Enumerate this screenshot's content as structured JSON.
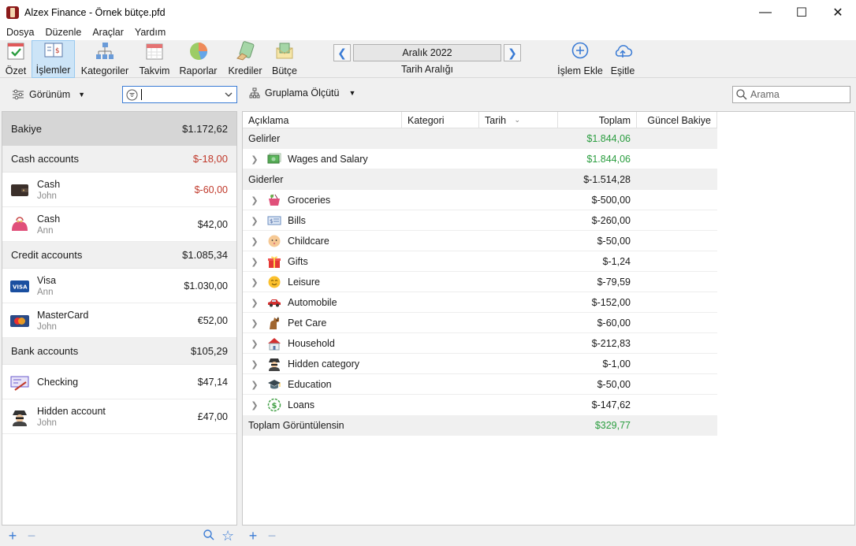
{
  "window": {
    "title": "Alzex Finance - Örnek bütçe.pfd"
  },
  "menu": [
    "Dosya",
    "Düzenle",
    "Araçlar",
    "Yardım"
  ],
  "toolbar": {
    "tools": [
      {
        "label": "Özet",
        "icon": "summary-icon"
      },
      {
        "label": "İşlemler",
        "icon": "transactions-icon",
        "active": true
      },
      {
        "label": "Kategoriler",
        "icon": "categories-icon"
      },
      {
        "label": "Takvim",
        "icon": "calendar-icon"
      },
      {
        "label": "Raporlar",
        "icon": "reports-icon"
      },
      {
        "label": "Krediler",
        "icon": "loans-icon"
      },
      {
        "label": "Bütçe",
        "icon": "budget-icon"
      }
    ],
    "date_range": {
      "value": "Aralık 2022",
      "caption": "Tarih Aralığı"
    },
    "add_transaction": "İşlem Ekle",
    "sync": "Eşitle"
  },
  "subbar": {
    "view_label": "Görünüm",
    "group_label": "Gruplama Ölçütü",
    "search_placeholder": "Arama"
  },
  "accounts": {
    "balance": {
      "label": "Bakiye",
      "amount": "$1.172,62"
    },
    "groups": [
      {
        "name": "Cash accounts",
        "amount": "$-18,00",
        "items": [
          {
            "name": "Cash",
            "owner": "John",
            "amount": "$-60,00"
          },
          {
            "name": "Cash",
            "owner": "Ann",
            "amount": "$42,00"
          }
        ]
      },
      {
        "name": "Credit accounts",
        "amount": "$1.085,34",
        "items": [
          {
            "name": "Visa",
            "owner": "Ann",
            "amount": "$1.030,00"
          },
          {
            "name": "MasterCard",
            "owner": "John",
            "amount": "€52,00"
          }
        ]
      },
      {
        "name": "Bank accounts",
        "amount": "$105,29",
        "items": [
          {
            "name": "Checking",
            "owner": "",
            "amount": "$47,14"
          },
          {
            "name": "Hidden account",
            "owner": "John",
            "amount": "£47,00"
          }
        ]
      }
    ]
  },
  "table": {
    "columns": [
      "Açıklama",
      "Kategori",
      "Tarih",
      "Toplam",
      "Güncel Bakiye"
    ],
    "income": {
      "label": "Gelirler",
      "total": "$1.844,06"
    },
    "income_rows": [
      {
        "name": "Wages and Salary",
        "total": "$1.844,06"
      }
    ],
    "expense": {
      "label": "Giderler",
      "total": "$-1.514,28"
    },
    "expense_rows": [
      {
        "name": "Groceries",
        "total": "$-500,00"
      },
      {
        "name": "Bills",
        "total": "$-260,00"
      },
      {
        "name": "Childcare",
        "total": "$-50,00"
      },
      {
        "name": "Gifts",
        "total": "$-1,24"
      },
      {
        "name": "Leisure",
        "total": "$-79,59"
      },
      {
        "name": "Automobile",
        "total": "$-152,00"
      },
      {
        "name": "Pet Care",
        "total": "$-60,00"
      },
      {
        "name": "Household",
        "total": "$-212,83"
      },
      {
        "name": "Hidden category",
        "total": "$-1,00"
      },
      {
        "name": "Education",
        "total": "$-50,00"
      },
      {
        "name": "Loans",
        "total": "$-147,62"
      }
    ],
    "footer": {
      "label": "Toplam Görüntülensin",
      "total": "$329,77"
    }
  },
  "colors": {
    "accent": "#3a7bd5",
    "positive": "#2a9d3f",
    "negative": "#c0392b"
  }
}
